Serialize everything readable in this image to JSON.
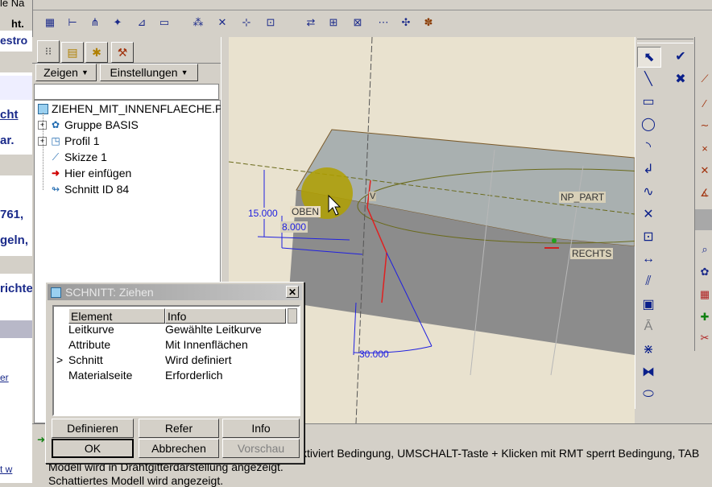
{
  "left_fragments": [
    "le Na",
    "ht.",
    "estro",
    "cht",
    ")",
    "ar.",
    "761,",
    "geln,",
    "richte",
    "er",
    "t w"
  ],
  "tabs": [
    {
      "icon": "tree-icon"
    },
    {
      "icon": "layers-icon"
    },
    {
      "icon": "star-folder-icon"
    },
    {
      "icon": "tools-icon"
    }
  ],
  "tree_toolbar": {
    "show_label": "Zeigen",
    "settings_label": "Einstellungen"
  },
  "tree": [
    {
      "label": "ZIEHEN_MIT_INNENFLAECHE.P",
      "icon": "part-icon",
      "expander": ""
    },
    {
      "label": "Gruppe BASIS",
      "icon": "group-icon",
      "expander": "+"
    },
    {
      "label": "Profil 1",
      "icon": "profile-icon",
      "expander": "+"
    },
    {
      "label": "Skizze 1",
      "icon": "sketch-icon",
      "expander": ""
    },
    {
      "label": "Hier einfügen",
      "icon": "insert-arrow-icon",
      "expander": ""
    },
    {
      "label": "Schnitt ID 84",
      "icon": "section-icon",
      "expander": ""
    }
  ],
  "dialog": {
    "title": "SCHNITT: Ziehen",
    "col_element": "Element",
    "col_info": "Info",
    "rows": [
      {
        "marker": "",
        "element": "Leitkurve",
        "info": "Gewählte Leitkurve"
      },
      {
        "marker": "",
        "element": "Attribute",
        "info": "Mit Innenflächen"
      },
      {
        "marker": ">",
        "element": "Schnitt",
        "info": "Wird definiert"
      },
      {
        "marker": "",
        "element": "Materialseite",
        "info": "Erforderlich"
      }
    ],
    "buttons": {
      "define": "Definieren",
      "refer": "Refer",
      "info": "Info",
      "ok": "OK",
      "cancel": "Abbrechen",
      "preview": "Vorschau"
    }
  },
  "viewport": {
    "dims": {
      "d1": "15.000",
      "d2": "8.000",
      "d3": "30.000"
    },
    "labels": {
      "top": "OBEN",
      "v": "V",
      "np_part": "NP_PART",
      "right": "RECHTS"
    }
  },
  "messages": [
    "ktiviert Bedingung, UMSCHALT-Taste + Klicken mit RMT sperrt Bedingung, TAB",
    "Modell wird in Drahtgitterdarstellung angezeigt.",
    "Schattiertes Modell wird angezeigt."
  ],
  "colors": {
    "accent": "#1a2a8a",
    "viewport_bg": "#e9e2cf",
    "dialog_title_bg": "#a8a8a8"
  }
}
